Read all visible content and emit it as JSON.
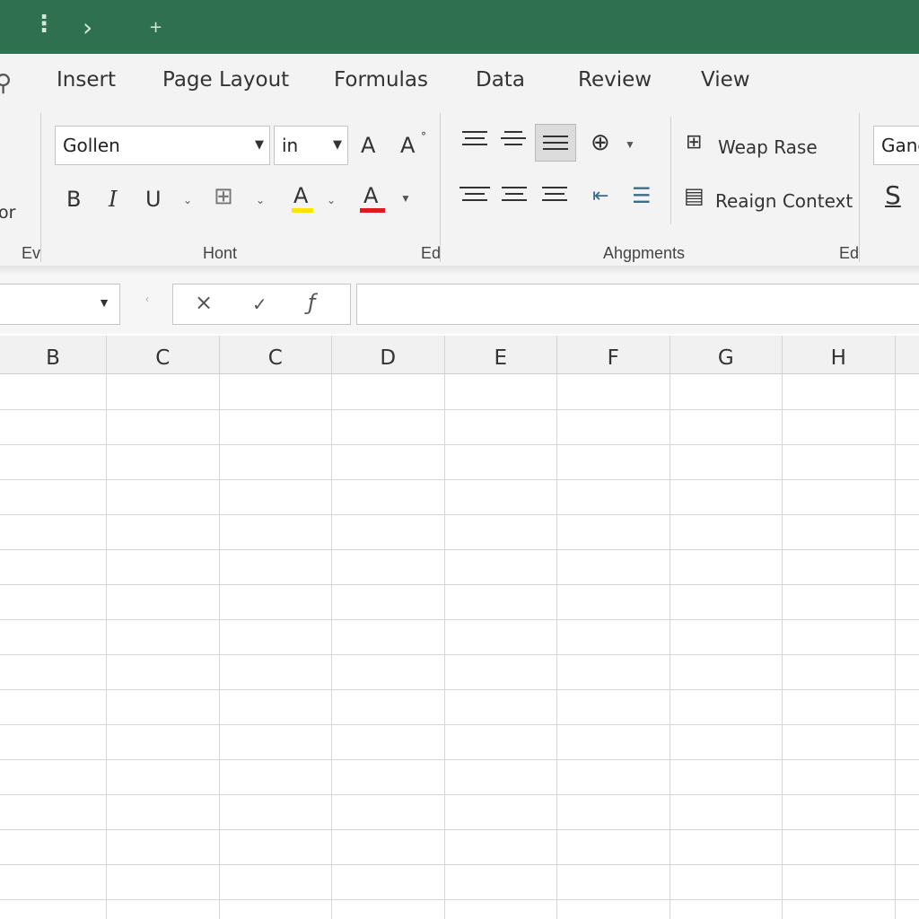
{
  "titlebar": {
    "arrow": "›",
    "plus": "+"
  },
  "tabs": [
    {
      "id": "insert",
      "label": "Insert"
    },
    {
      "id": "page-layout",
      "label": "Page Layout"
    },
    {
      "id": "formulas",
      "label": "Formulas"
    },
    {
      "id": "data",
      "label": "Data"
    },
    {
      "id": "review",
      "label": "Review"
    },
    {
      "id": "view",
      "label": "View"
    }
  ],
  "ribbon": {
    "left_partial_text": "or",
    "left_group_label": "Ev",
    "font": {
      "font_name": "Gollen",
      "font_size": "in",
      "grow": "A",
      "shrink": "A",
      "bold": "B",
      "italic": "I",
      "underline": "U",
      "highlight": "A",
      "font_color": "A",
      "highlight_color": "#ffe400",
      "font_color_bar": "#e0191f",
      "group_label": "Hont",
      "group_label_right": "Ed"
    },
    "alignment": {
      "wrap_label": "Weap Rase",
      "realign_label": "Reaign Context",
      "group_label": "Ahgpments",
      "group_label_right": "Ed"
    },
    "number": {
      "format_partial": "Ganc",
      "currency": "S"
    }
  },
  "formula_bar": {
    "cancel": "×",
    "enter": "✓",
    "fx": "ƒ"
  },
  "grid": {
    "columns": [
      "B",
      "C",
      "C",
      "D",
      "E",
      "F",
      "G",
      "H"
    ]
  }
}
